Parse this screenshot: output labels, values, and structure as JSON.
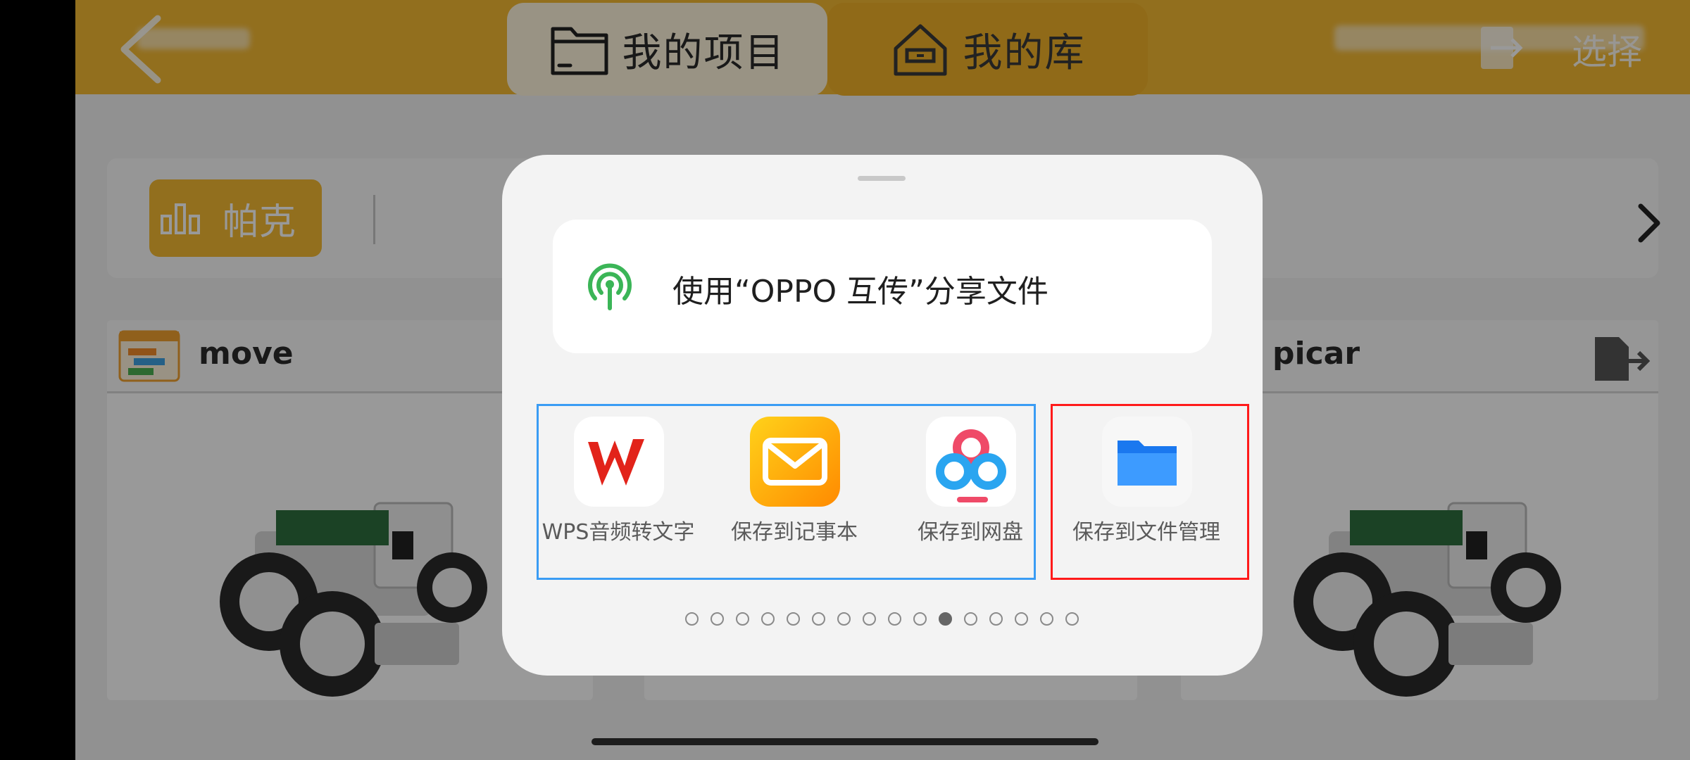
{
  "header": {
    "tabs": [
      {
        "label": "我的项目",
        "icon": "folder-icon",
        "active": true
      },
      {
        "label": "我的库",
        "icon": "house-icon",
        "active": false
      }
    ],
    "select_label": "选择"
  },
  "filter": {
    "chip_label": "帕克",
    "chip_icon": "blocks-icon"
  },
  "projects": [
    {
      "title": "move"
    },
    {
      "title": "picar"
    }
  ],
  "share_sheet": {
    "transfer_label": "使用“OPPO 互传”分享文件",
    "apps": [
      {
        "label": "WPS音频转文字",
        "icon": "wps-icon"
      },
      {
        "label": "保存到记事本",
        "icon": "notes-mail-icon"
      },
      {
        "label": "保存到网盘",
        "icon": "netdisk-cloud-icon"
      },
      {
        "label": "保存到文件管理",
        "icon": "file-manager-folder-icon"
      }
    ],
    "page_indicator": {
      "total": 16,
      "active_index": 10
    }
  },
  "colors": {
    "brand": "#f4b933",
    "highlight_blue": "#3a9cf4",
    "highlight_red": "#ff1a1a",
    "transfer_green": "#3bb557"
  }
}
